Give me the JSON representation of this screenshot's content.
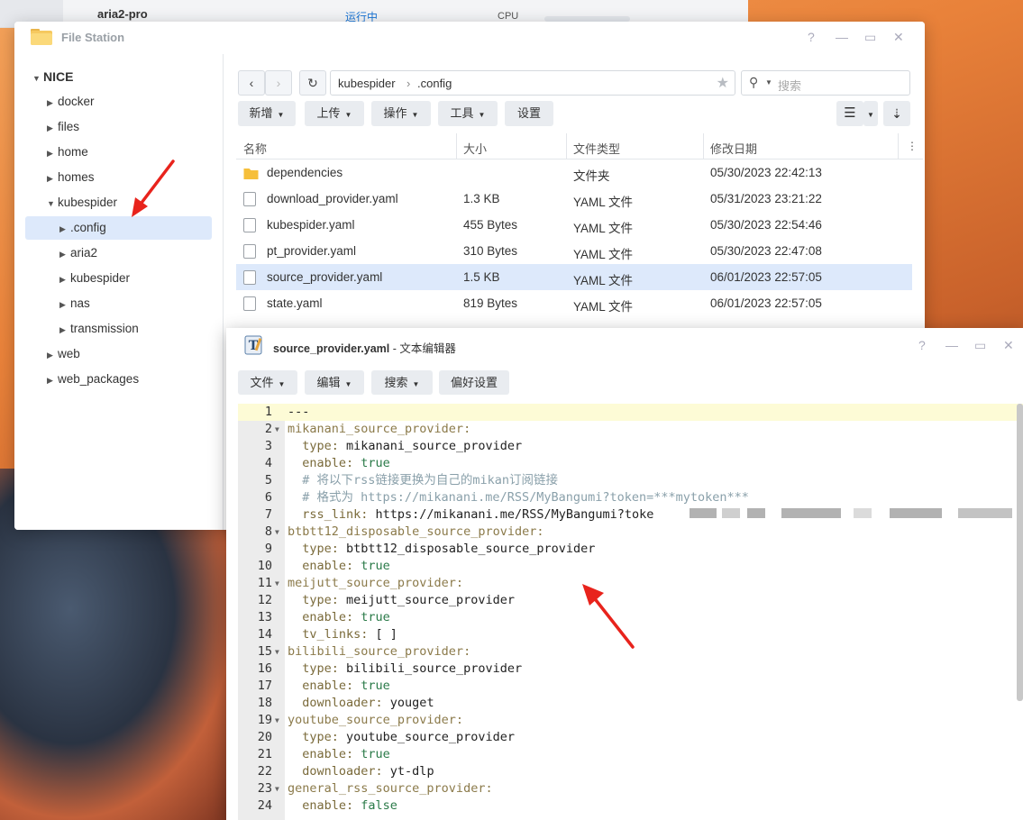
{
  "background": {
    "header_name": "aria2-pro",
    "header_status": "运行中",
    "header_cpu": "CPU"
  },
  "file_station": {
    "title": "File Station",
    "controls": [
      "?",
      "—",
      "▭",
      "✕"
    ],
    "tree": [
      {
        "label": "NICE",
        "level": 0,
        "expanded": true
      },
      {
        "label": "docker",
        "level": 1
      },
      {
        "label": "files",
        "level": 1
      },
      {
        "label": "home",
        "level": 1
      },
      {
        "label": "homes",
        "level": 1
      },
      {
        "label": "kubespider",
        "level": 1,
        "expanded": true
      },
      {
        "label": ".config",
        "level": 2,
        "selected": true
      },
      {
        "label": "aria2",
        "level": 2
      },
      {
        "label": "kubespider",
        "level": 2
      },
      {
        "label": "nas",
        "level": 2
      },
      {
        "label": "transmission",
        "level": 2
      },
      {
        "label": "web",
        "level": 1
      },
      {
        "label": "web_packages",
        "level": 1
      }
    ],
    "path": {
      "segment1": "kubespider",
      "separator": "›",
      "segment2": ".config"
    },
    "search_placeholder": "搜索",
    "toolbar": {
      "new": "新增",
      "upload": "上传",
      "action": "操作",
      "tools": "工具",
      "settings": "设置"
    },
    "columns": {
      "name": "名称",
      "size": "大小",
      "type": "文件类型",
      "modified": "修改日期"
    },
    "files": [
      {
        "name": "dependencies",
        "size": "",
        "type": "文件夹",
        "modified": "05/30/2023 22:42:13",
        "folder": true
      },
      {
        "name": "download_provider.yaml",
        "size": "1.3 KB",
        "type": "YAML 文件",
        "modified": "05/31/2023 23:21:22"
      },
      {
        "name": "kubespider.yaml",
        "size": "455 Bytes",
        "type": "YAML 文件",
        "modified": "05/30/2023 22:54:46"
      },
      {
        "name": "pt_provider.yaml",
        "size": "310 Bytes",
        "type": "YAML 文件",
        "modified": "05/30/2023 22:47:08"
      },
      {
        "name": "source_provider.yaml",
        "size": "1.5 KB",
        "type": "YAML 文件",
        "modified": "06/01/2023 22:57:05",
        "selected": true
      },
      {
        "name": "state.yaml",
        "size": "819 Bytes",
        "type": "YAML 文件",
        "modified": "06/01/2023 22:57:05"
      }
    ]
  },
  "editor": {
    "title_file": "source_provider.yaml",
    "title_app": " - 文本编辑器",
    "menu": {
      "file": "文件",
      "edit": "编辑",
      "search": "搜索",
      "prefs": "偏好设置"
    },
    "lines": [
      {
        "n": "1",
        "key": "",
        "val": "---",
        "kind": "plain",
        "fold": false
      },
      {
        "n": "2",
        "key": "mikanani_source_provider:",
        "val": "",
        "kind": "top",
        "fold": true
      },
      {
        "n": "3",
        "key": "  type:",
        "val": " mikanani_source_provider",
        "kind": "kv",
        "fold": false
      },
      {
        "n": "4",
        "key": "  enable:",
        "val": " true",
        "kind": "bool",
        "fold": false
      },
      {
        "n": "5",
        "key": "",
        "val": "  # 将以下rss链接更换为自己的mikan订阅链接",
        "kind": "comment",
        "fold": false
      },
      {
        "n": "6",
        "key": "",
        "val": "  # 格式为 https://mikanani.me/RSS/MyBangumi?token=***mytoken***",
        "kind": "comment",
        "fold": false
      },
      {
        "n": "7",
        "key": "  rss_link:",
        "val": " https://mikanani.me/RSS/MyBangumi?toke",
        "kind": "kv",
        "fold": false
      },
      {
        "n": "8",
        "key": "btbtt12_disposable_source_provider:",
        "val": "",
        "kind": "top",
        "fold": true
      },
      {
        "n": "9",
        "key": "  type:",
        "val": " btbtt12_disposable_source_provider",
        "kind": "kv",
        "fold": false
      },
      {
        "n": "10",
        "key": "  enable:",
        "val": " true",
        "kind": "bool",
        "fold": false
      },
      {
        "n": "11",
        "key": "meijutt_source_provider:",
        "val": "",
        "kind": "top",
        "fold": true
      },
      {
        "n": "12",
        "key": "  type:",
        "val": " meijutt_source_provider",
        "kind": "kv",
        "fold": false
      },
      {
        "n": "13",
        "key": "  enable:",
        "val": " true",
        "kind": "bool",
        "fold": false
      },
      {
        "n": "14",
        "key": "  tv_links:",
        "val": " [ ]",
        "kind": "kv",
        "fold": false
      },
      {
        "n": "15",
        "key": "bilibili_source_provider:",
        "val": "",
        "kind": "top",
        "fold": true
      },
      {
        "n": "16",
        "key": "  type:",
        "val": " bilibili_source_provider",
        "kind": "kv",
        "fold": false
      },
      {
        "n": "17",
        "key": "  enable:",
        "val": " true",
        "kind": "bool",
        "fold": false
      },
      {
        "n": "18",
        "key": "  downloader:",
        "val": " youget",
        "kind": "kv",
        "fold": false
      },
      {
        "n": "19",
        "key": "youtube_source_provider:",
        "val": "",
        "kind": "top",
        "fold": true
      },
      {
        "n": "20",
        "key": "  type:",
        "val": " youtube_source_provider",
        "kind": "kv",
        "fold": false
      },
      {
        "n": "21",
        "key": "  enable:",
        "val": " true",
        "kind": "bool",
        "fold": false
      },
      {
        "n": "22",
        "key": "  downloader:",
        "val": " yt-dlp",
        "kind": "kv",
        "fold": false
      },
      {
        "n": "23",
        "key": "general_rss_source_provider:",
        "val": "",
        "kind": "top",
        "fold": true
      },
      {
        "n": "24",
        "key": "  enable:",
        "val": " false",
        "kind": "bool",
        "fold": false
      }
    ]
  },
  "colors": {
    "accent": "#1a74d4",
    "selection": "#dde9fb",
    "annotation_arrow": "#e8231c"
  }
}
